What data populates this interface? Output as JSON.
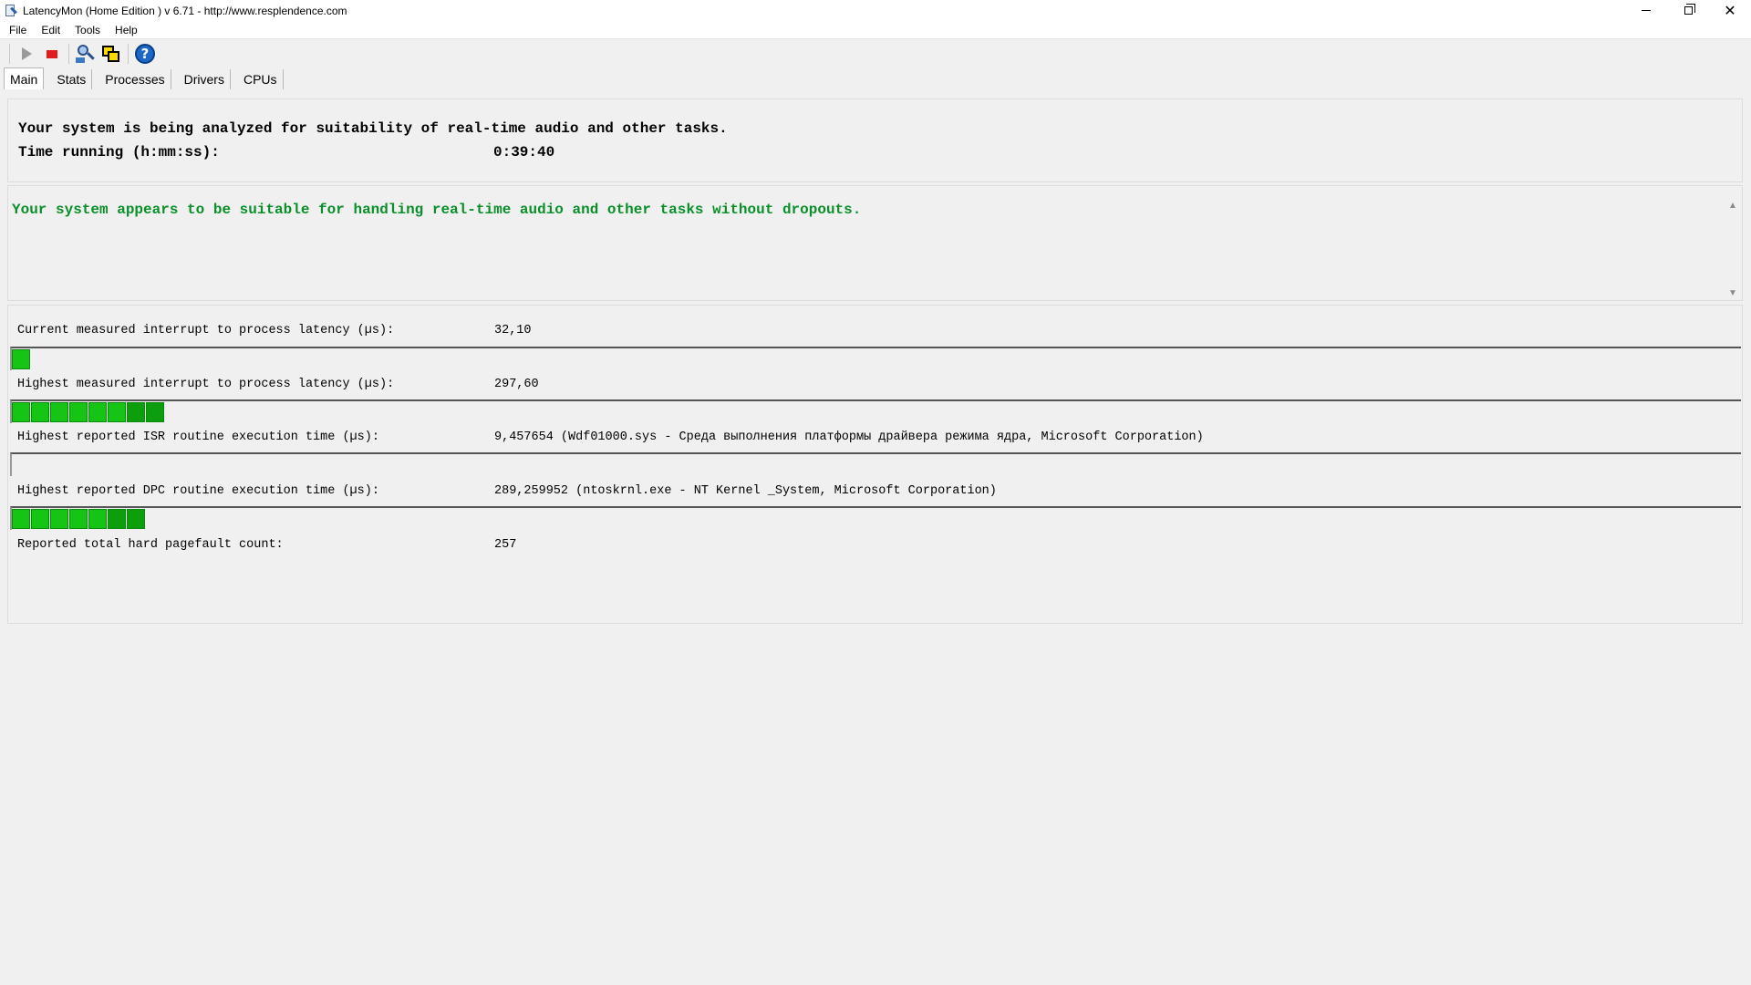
{
  "window": {
    "title": "LatencyMon  (Home Edition )  v 6.71 - http://www.resplendence.com"
  },
  "menu": [
    "File",
    "Edit",
    "Tools",
    "Help"
  ],
  "toolbar": {
    "icons": [
      "play-icon",
      "stop-icon",
      "find-driver-icon",
      "windows-icon",
      "help-icon"
    ]
  },
  "tabs": [
    "Main",
    "Stats",
    "Processes",
    "Drivers",
    "CPUs"
  ],
  "main": {
    "analyze_text": "Your system is being analyzed for suitability of real-time audio and other tasks.",
    "time_label": "Time running (h:mm:ss):",
    "time_value": "0:39:40",
    "message": "Your system appears to be suitable for handling real-time audio and other tasks without dropouts.",
    "message_color": "#0a8f2a",
    "metrics": [
      {
        "label": "Current measured interrupt to process latency (µs):",
        "value": "32,10",
        "bar_segments": 1
      },
      {
        "label": "Highest measured interrupt to process latency (µs):",
        "value": "297,60",
        "bar_segments": 8
      },
      {
        "label": "Highest reported ISR routine execution time (µs):",
        "value": "9,457654   (Wdf01000.sys - Среда выполнения платформы драйвера режима ядра, Microsoft Corporation)",
        "bar_segments": 0
      },
      {
        "label": "Highest reported DPC routine execution time (µs):",
        "value": "289,259952   (ntoskrnl.exe - NT Kernel _System, Microsoft Corporation)",
        "bar_segments": 7
      },
      {
        "label": "Reported total hard pagefault count:",
        "value": "257"
      }
    ],
    "bar_color": "#16c416"
  }
}
